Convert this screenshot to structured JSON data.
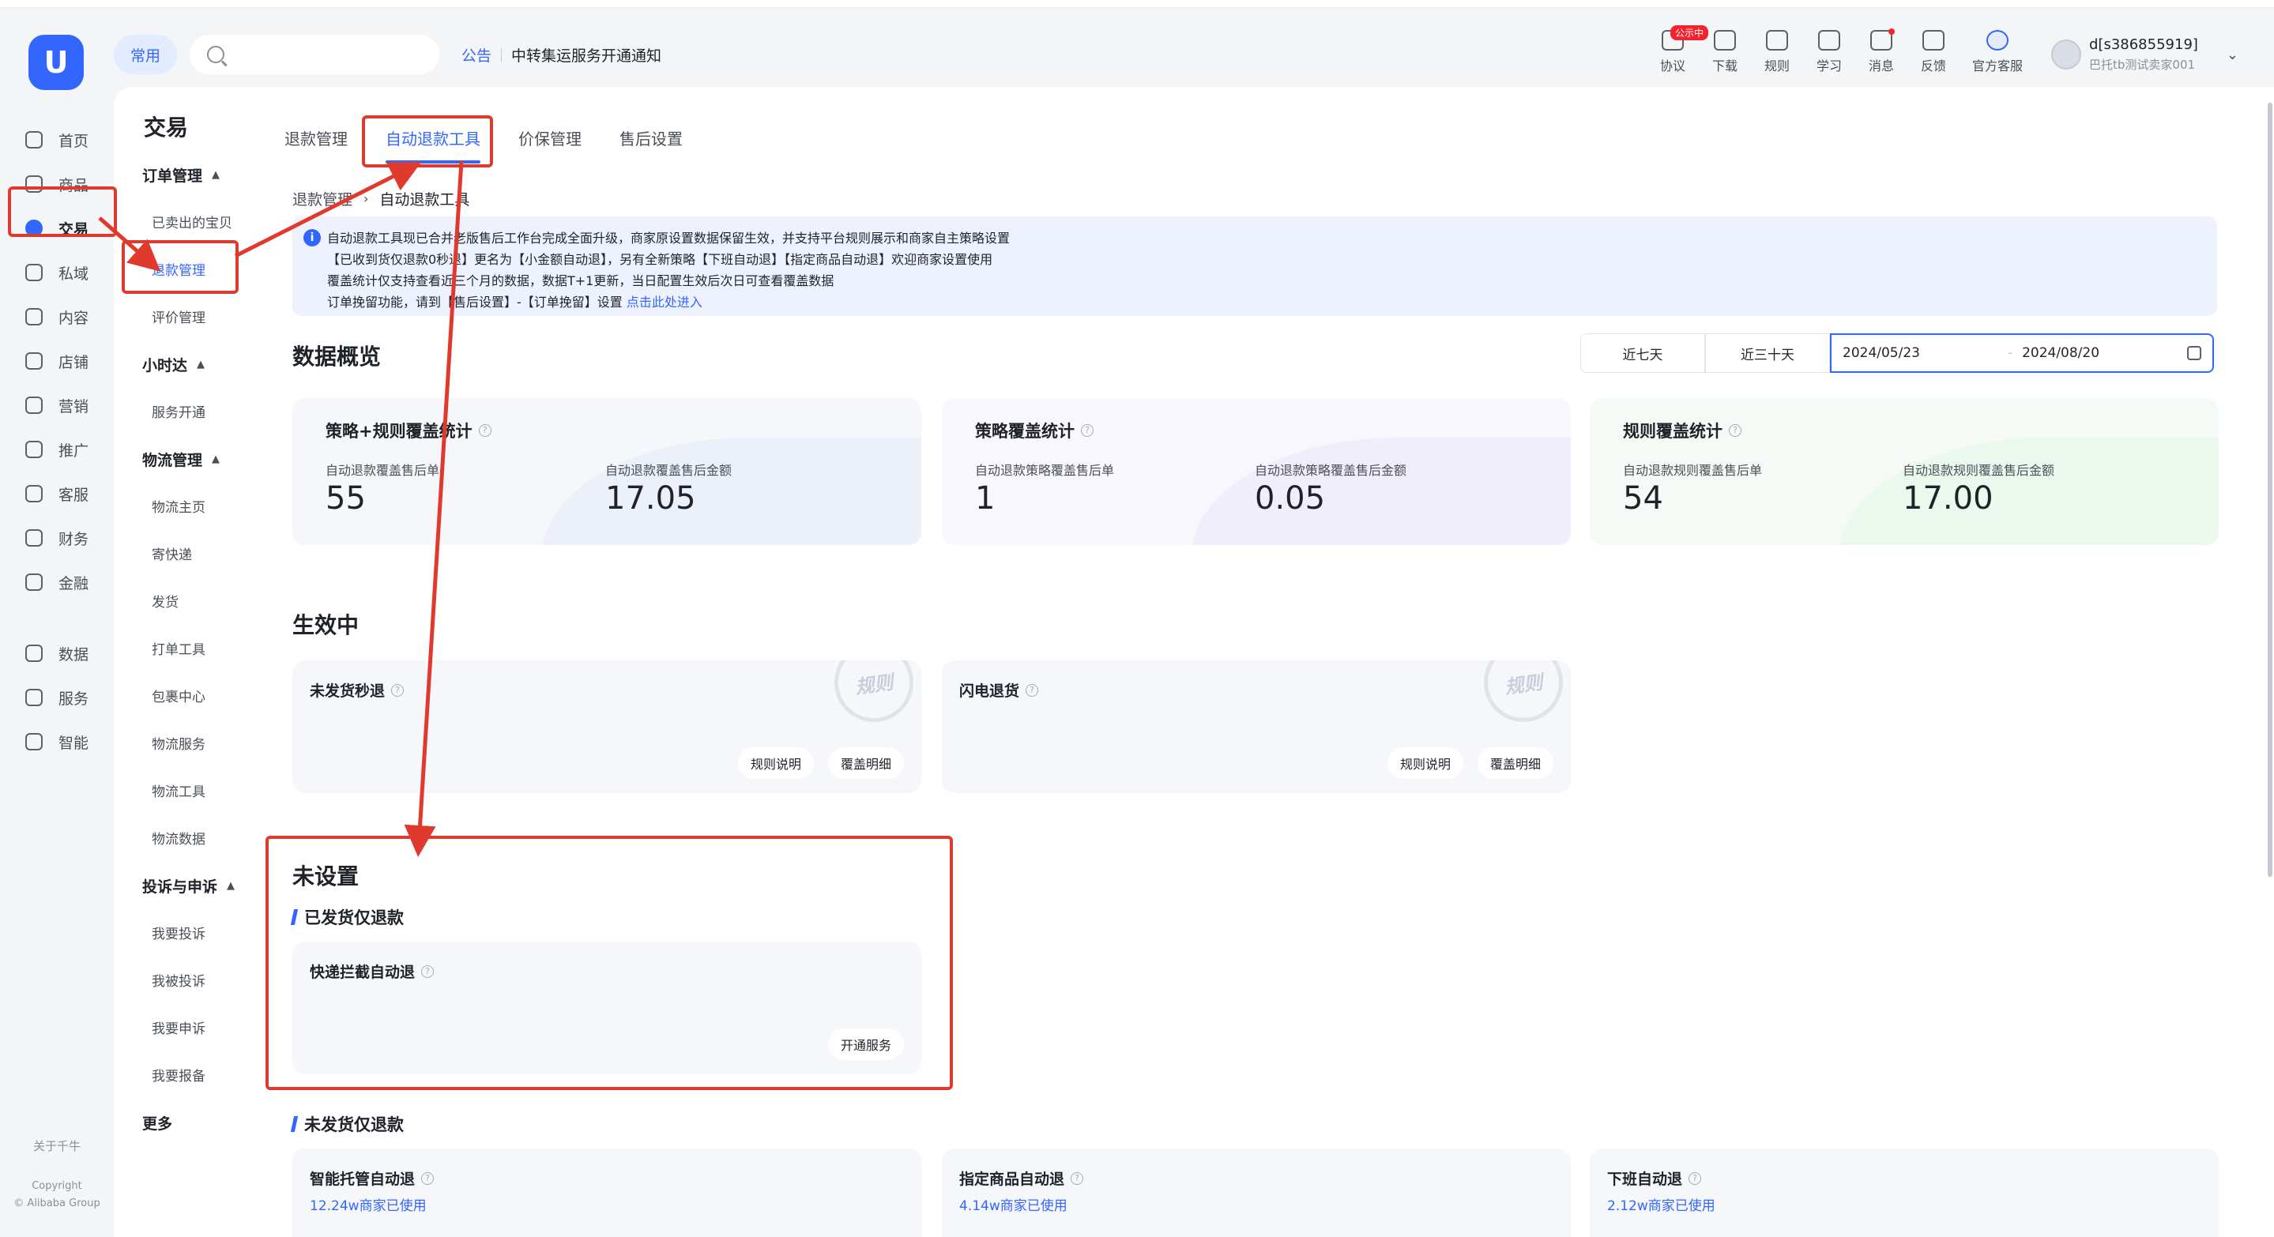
{
  "header": {
    "logo": "U",
    "common_chip": "常用",
    "search_placeholder": "",
    "notice_tag": "公告",
    "notice_text": "中转集运服务开通通知",
    "icons": [
      {
        "name": "agreement-icon",
        "label": "协议",
        "badge": "公示中"
      },
      {
        "name": "download-icon",
        "label": "下载"
      },
      {
        "name": "rules-icon",
        "label": "规则"
      },
      {
        "name": "learn-icon",
        "label": "学习"
      },
      {
        "name": "message-icon",
        "label": "消息",
        "dot": true
      },
      {
        "name": "feedback-icon",
        "label": "反馈"
      },
      {
        "name": "customer-service-icon",
        "label": "官方客服"
      }
    ],
    "user": {
      "name": "d[s386855919]",
      "sub": "巴托tb测试卖家001"
    }
  },
  "rail": {
    "items": [
      "首页",
      "商品",
      "交易",
      "私域",
      "内容",
      "店铺",
      "营销",
      "推广",
      "客服",
      "财务",
      "金融",
      "数据",
      "服务",
      "智能"
    ],
    "active": "交易",
    "footer_about": "关于千牛",
    "footer_copyright": "Copyright",
    "footer_company": "© Alibaba Group"
  },
  "subnav": {
    "title": "交易",
    "groups": [
      {
        "label": "订单管理",
        "items": [
          "已卖出的宝贝",
          "退款管理",
          "评价管理"
        ]
      },
      {
        "label": "小时达",
        "items": [
          "服务开通"
        ]
      },
      {
        "label": "物流管理",
        "items": [
          "物流主页",
          "寄快递",
          "发货",
          "打单工具",
          "包裹中心",
          "物流服务",
          "物流工具",
          "物流数据"
        ]
      },
      {
        "label": "投诉与申诉",
        "items": [
          "我要投诉",
          "我被投诉",
          "我要申诉",
          "我要报备"
        ]
      }
    ],
    "more": "更多",
    "active_item": "退款管理"
  },
  "tabs": [
    "退款管理",
    "自动退款工具",
    "价保管理",
    "售后设置"
  ],
  "active_tab": "自动退款工具",
  "breadcrumb": {
    "parent": "退款管理",
    "current": "自动退款工具"
  },
  "info": {
    "lines": [
      "自动退款工具现已合并老版售后工作台完成全面升级，商家原设置数据保留生效，并支持平台规则展示和商家自主策略设置",
      "【已收到货仅退款0秒退】更名为【小金额自动退】，另有全新策略【下班自动退】【指定商品自动退】欢迎商家设置使用",
      "覆盖统计仅支持查看近三个月的数据，数据T+1更新，当日配置生效后次日可查看覆盖数据"
    ],
    "last_line": "订单挽留功能，请到【售后设置】-【订单挽留】设置",
    "link": "点击此处进入"
  },
  "overview": {
    "title": "数据概览",
    "range_buttons": [
      "近七天",
      "近三十天"
    ],
    "start_date": "2024/05/23",
    "to": "-",
    "end_date": "2024/08/20",
    "cards": [
      {
        "title": "策略+规则覆盖统计",
        "l1": "自动退款覆盖售后单",
        "v1": "55",
        "l2": "自动退款覆盖售后金额",
        "v2": "17.05",
        "accent": "#e6ebf7"
      },
      {
        "title": "策略覆盖统计",
        "l1": "自动退款策略覆盖售后单",
        "v1": "1",
        "l2": "自动退款策略覆盖售后金额",
        "v2": "0.05",
        "accent": "#ece8fb"
      },
      {
        "title": "规则覆盖统计",
        "l1": "自动退款规则覆盖售后单",
        "v1": "54",
        "l2": "自动退款规则覆盖售后金额",
        "v2": "17.00",
        "accent": "#e4f6e9"
      }
    ]
  },
  "active_section": {
    "title": "生效中",
    "cards": [
      {
        "title": "未发货秒退",
        "stamp": "规则",
        "btn1": "规则说明",
        "btn2": "覆盖明细"
      },
      {
        "title": "闪电退货",
        "stamp": "规则",
        "btn1": "规则说明",
        "btn2": "覆盖明细"
      }
    ]
  },
  "unset_section": {
    "title": "未设置",
    "group1": "已发货仅退款",
    "card1": {
      "title": "快递拦截自动退",
      "btn": "开通服务"
    },
    "group2": "未发货仅退款",
    "cards2": [
      {
        "title": "智能托管自动退",
        "sub": "12.24w商家已使用"
      },
      {
        "title": "指定商品自动退",
        "sub": "4.14w商家已使用"
      },
      {
        "title": "下班自动退",
        "sub": "2.12w商家已使用"
      }
    ]
  },
  "colors": {
    "accent": "#3366ff",
    "annotation": "#e03a2f"
  }
}
